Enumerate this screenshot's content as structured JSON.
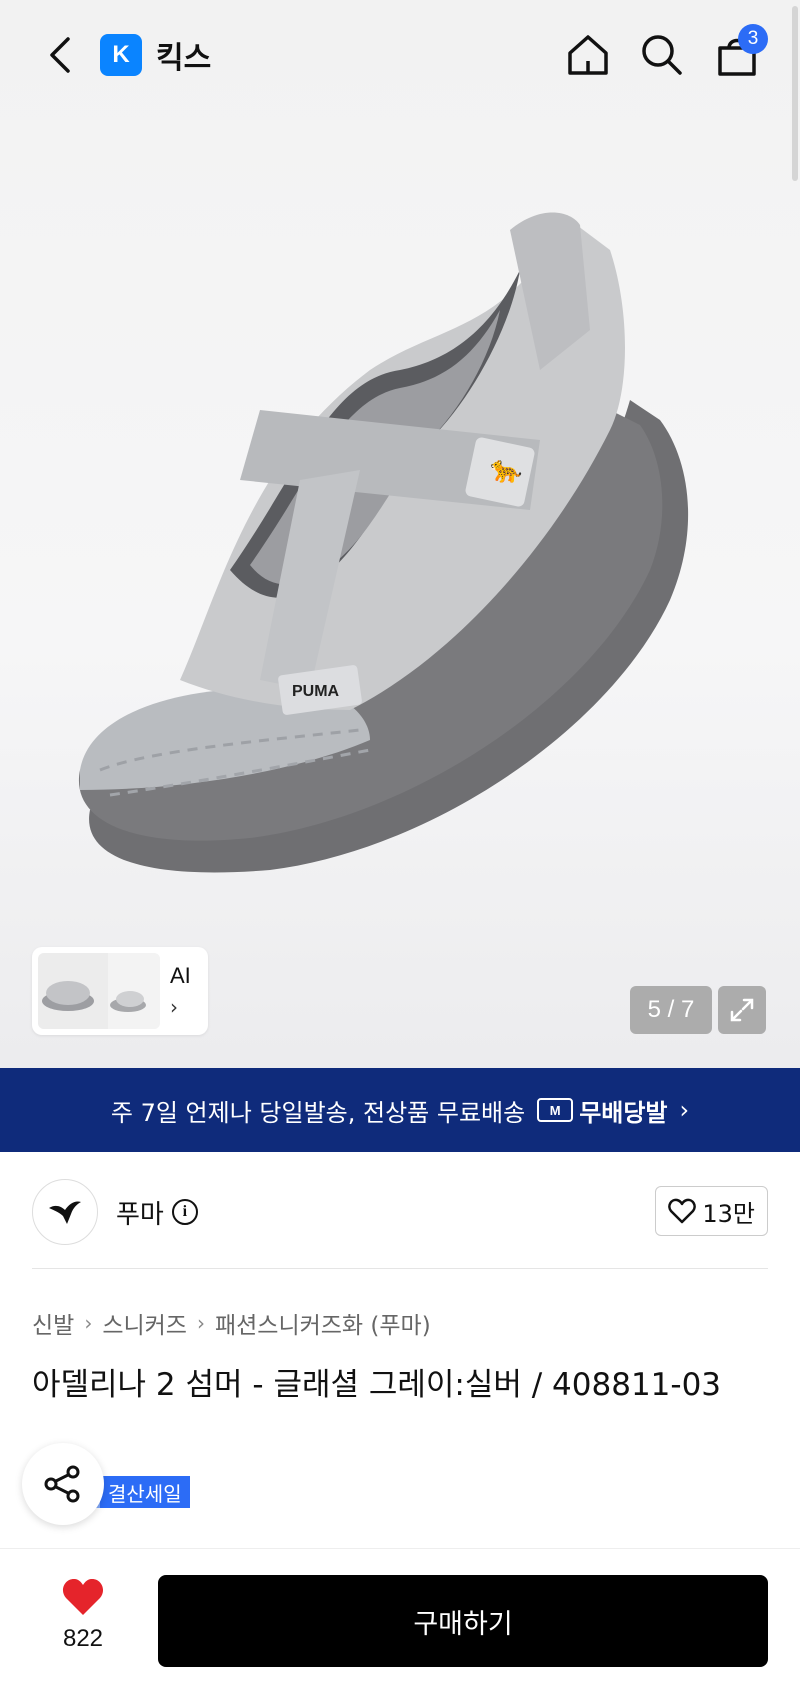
{
  "header": {
    "brand_logo_letter": "K",
    "brand_name": "킥스",
    "cart_count": "3"
  },
  "gallery": {
    "ai_label": "AI",
    "pager": "5 / 7"
  },
  "banner": {
    "text": "주 7일 언제나 당일발송, 전상품 무료배송",
    "badge_mark": "M",
    "badge_label": "무배당발"
  },
  "brand": {
    "name": "푸마",
    "likes": "13만"
  },
  "breadcrumb": [
    "신발",
    "스니커즈",
    "패션스니커즈화 (푸마)"
  ],
  "product": {
    "title": "아델리나 2 섬머 - 글래셜 그레이:실버 / 408811-03",
    "sale_badge": "결산세일"
  },
  "bottom_bar": {
    "wish_count": "822",
    "buy_label": "구매하기"
  },
  "colors": {
    "brand_blue": "#0a84ff",
    "badge_blue": "#2c6cf6",
    "banner_navy": "#0f2b7b",
    "heart_red": "#e5242b"
  }
}
